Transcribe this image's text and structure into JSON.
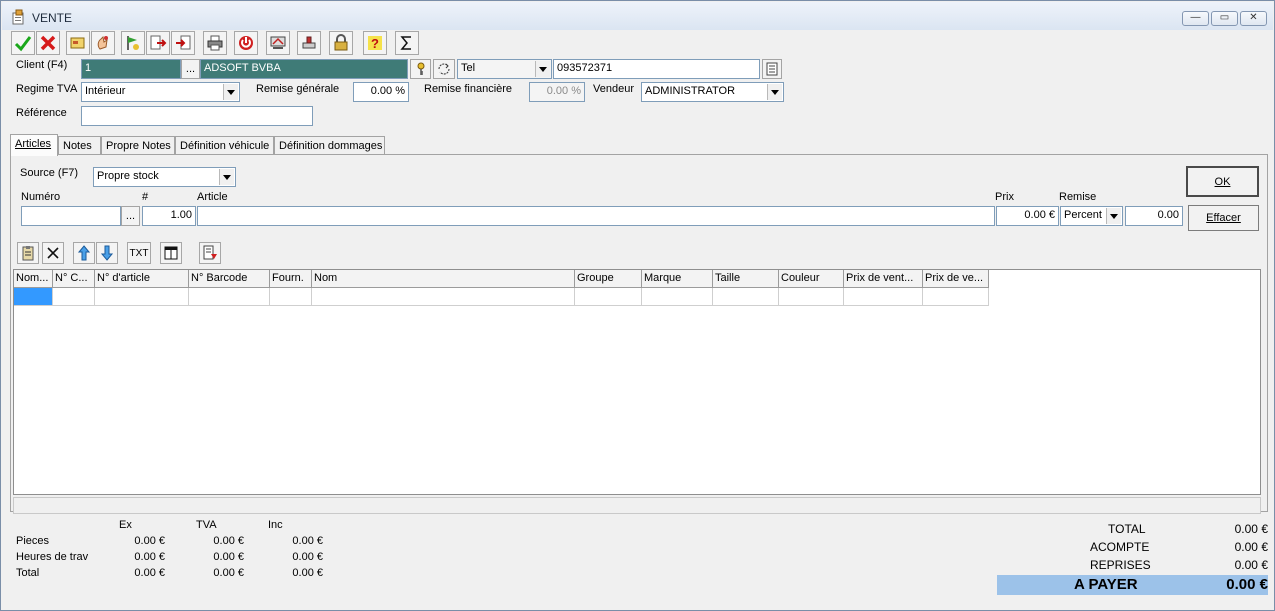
{
  "window": {
    "title": "VENTE",
    "minimize": "—",
    "maximize": "▭",
    "close": "✕"
  },
  "toolbar": [
    "check-icon",
    "cross-icon",
    "card-icon",
    "hand-icon",
    "flag-icon",
    "arrow-doc-icon",
    "doc-arrow-icon",
    "printer-icon",
    "power-icon",
    "screen-icon",
    "stamp-icon",
    "lock-icon",
    "help-icon",
    "sigma-icon"
  ],
  "header": {
    "client_label": "Client (F4)",
    "client_code": "1",
    "client_browse": "...",
    "client_name": "ADSOFT BVBA",
    "contact_type": "Tel",
    "contact_value": "093572371",
    "regime_label": "Regime TVA",
    "regime_value": "Intérieur",
    "remise_generale_label": "Remise générale",
    "remise_generale_value": "0.00 %",
    "remise_financiere_label": "Remise financière",
    "remise_financiere_value": "0.00 %",
    "vendeur_label": "Vendeur",
    "vendeur_value": "ADMINISTRATOR",
    "reference_label": "Référence",
    "reference_value": ""
  },
  "tabs": [
    "Articles",
    "Notes",
    "Propre Notes",
    "Définition véhicule",
    "Définition dommages"
  ],
  "articles": {
    "source_label": "Source (F7)",
    "source_value": "Propre stock",
    "numero_label": "Numéro",
    "qty_label": "#",
    "article_label": "Article",
    "prix_label": "Prix",
    "remise_label": "Remise",
    "numero_value": "",
    "numero_browse": "...",
    "qty_value": "1.00",
    "article_value": "",
    "prix_value": "0.00 €",
    "remise_type": "Percent",
    "remise_value": "0.00",
    "ok_label": "OK",
    "effacer_label": "Effacer",
    "txt_label": "TXT"
  },
  "grid": {
    "columns": [
      "Nom...",
      "N° C...",
      "N° d'article",
      "N° Barcode",
      "Fourn.",
      "Nom",
      "Groupe",
      "Marque",
      "Taille",
      "Couleur",
      "Prix de vent...",
      "Prix de ve..."
    ]
  },
  "summary": {
    "col_ex": "Ex",
    "col_tva": "TVA",
    "col_inc": "Inc",
    "rows": [
      {
        "label": "Pieces",
        "ex": "0.00 €",
        "tva": "0.00 €",
        "inc": "0.00 €"
      },
      {
        "label": "Heures de trav",
        "ex": "0.00 €",
        "tva": "0.00 €",
        "inc": "0.00 €"
      },
      {
        "label": "Total",
        "ex": "0.00 €",
        "tva": "0.00 €",
        "inc": "0.00 €"
      }
    ]
  },
  "totals": {
    "total_label": "TOTAL",
    "total_value": "0.00 €",
    "acompte_label": "ACOMPTE",
    "acompte_value": "0.00 €",
    "reprises_label": "REPRISES",
    "reprises_value": "0.00 €",
    "apayer_label": "A PAYER",
    "apayer_value": "0.00 €"
  }
}
